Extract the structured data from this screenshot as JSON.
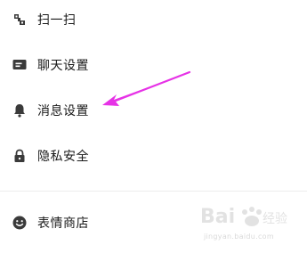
{
  "menu": {
    "items": [
      {
        "label": "扫一扫",
        "icon": "scan-icon"
      },
      {
        "label": "聊天设置",
        "icon": "chat-settings-icon"
      },
      {
        "label": "消息设置",
        "icon": "bell-icon"
      },
      {
        "label": "隐私安全",
        "icon": "lock-icon"
      },
      {
        "label": "表情商店",
        "icon": "smiley-icon"
      }
    ]
  },
  "annotation": {
    "arrow_color": "#e632e6"
  },
  "watermark": {
    "subtext": "jingyan.baidu.com"
  },
  "colors": {
    "text": "#1a1a1a",
    "icon": "#3a3a3a",
    "divider": "#ececec",
    "background": "#ffffff"
  }
}
